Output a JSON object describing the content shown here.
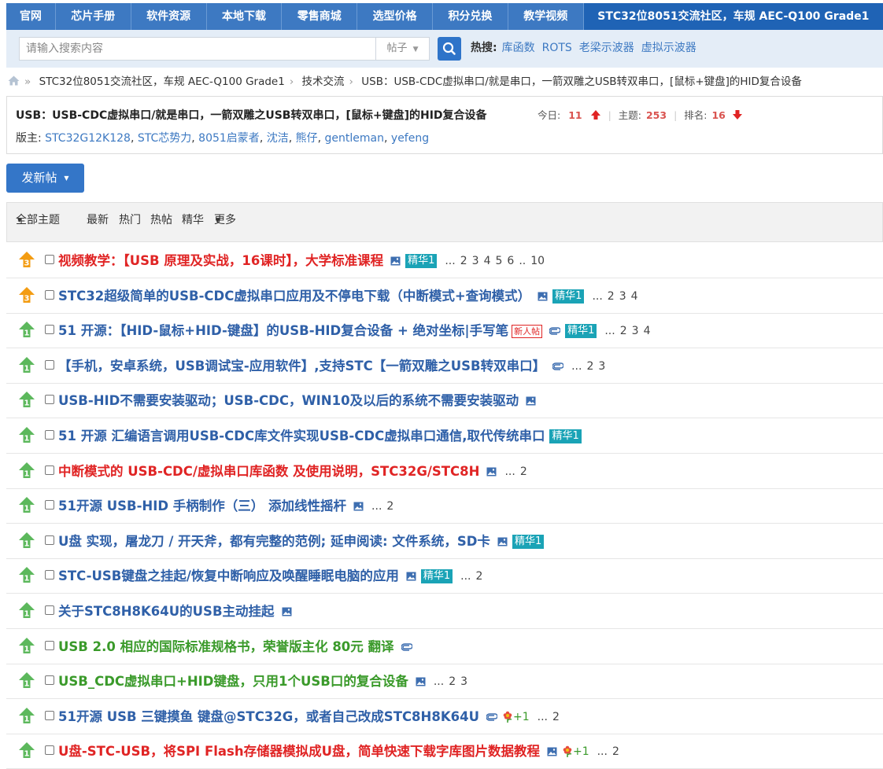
{
  "nav": {
    "items": [
      "官网",
      "芯片手册",
      "软件资源",
      "本地下载",
      "零售商城",
      "选型价格",
      "积分兑换",
      "教学视频"
    ],
    "active": "STC32位8051交流社区，车规 AEC-Q100 Grade1"
  },
  "search": {
    "placeholder": "请输入搜索内容",
    "type": "帖子",
    "hot_label": "热搜:",
    "hot": [
      "库函数",
      "ROTS",
      "老梁示波器",
      "虚拟示波器"
    ]
  },
  "breadcrumb": [
    "STC32位8051交流社区，车规 AEC-Q100 Grade1",
    "技术交流",
    "USB：USB-CDC虚拟串口/就是串口，一箭双雕之USB转双串口，[鼠标+键盘]的HID复合设备"
  ],
  "forum": {
    "title": "USB：USB-CDC虚拟串口/就是串口，一箭双雕之USB转双串口，[鼠标+键盘]的HID复合设备",
    "today_label": "今日:",
    "today": "11",
    "topics_label": "主题:",
    "topics": "253",
    "rank_label": "排名:",
    "rank": "16",
    "mods_label": "版主:",
    "mods": [
      "STC32G12K128",
      "STC芯势力",
      "8051启蒙者",
      "沈洁",
      "熊仔",
      "gentleman",
      "yefeng"
    ]
  },
  "new_post_label": "发新帖",
  "filters": {
    "all": "全部主题",
    "latest": "最新",
    "hot": "热门",
    "hotposts": "热帖",
    "digest": "精华",
    "more": "更多"
  },
  "colors": {
    "nav": "#3d79c2",
    "nav_active": "#1f63b5",
    "red": "#e02424",
    "blue": "#2f60a8",
    "green": "#3a9a2a",
    "digest": "#1aa3b6"
  },
  "threads": [
    {
      "icon": "pin-3-icon",
      "title": "视频教学：【USB 原理及实战，16课时】，大学标准课程",
      "color": "red",
      "image": true,
      "clip": false,
      "new": false,
      "digest": "精华1",
      "flower": "",
      "pages": [
        "...",
        "2",
        "3",
        "4",
        "5",
        "6",
        "..",
        "10"
      ]
    },
    {
      "icon": "pin-3-icon",
      "title": "STC32超级简单的USB-CDC虚拟串口应用及不停电下载（中断模式+查询模式）",
      "color": "blue",
      "image": true,
      "clip": false,
      "new": false,
      "digest": "精华1",
      "flower": "",
      "pages": [
        "...",
        "2",
        "3",
        "4"
      ]
    },
    {
      "icon": "pin-1-icon",
      "title": "51 开源：【HID-鼠标+HID-键盘】的USB-HID复合设备 + 绝对坐标|手写笔",
      "color": "blue",
      "image": false,
      "clip": true,
      "new": true,
      "new_label": "新人帖",
      "digest": "精华1",
      "flower": "",
      "pages": [
        "...",
        "2",
        "3",
        "4"
      ]
    },
    {
      "icon": "pin-1-icon",
      "title": "【手机，安卓系统，USB调试宝-应用软件】,支持STC【一箭双雕之USB转双串口】",
      "color": "blue",
      "image": false,
      "clip": true,
      "new": false,
      "digest": "",
      "flower": "",
      "pages": [
        "...",
        "2",
        "3"
      ]
    },
    {
      "icon": "pin-1-icon",
      "title": "USB-HID不需要安装驱动；USB-CDC，WIN10及以后的系统不需要安装驱动",
      "color": "blue",
      "image": true,
      "clip": false,
      "new": false,
      "digest": "",
      "flower": "",
      "pages": []
    },
    {
      "icon": "pin-1-icon",
      "title": "51 开源 汇编语言调用USB-CDC库文件实现USB-CDC虚拟串口通信,取代传统串口",
      "color": "blue",
      "image": false,
      "clip": false,
      "new": false,
      "digest": "精华1",
      "flower": "",
      "pages": []
    },
    {
      "icon": "pin-1-icon",
      "title": "中断模式的 USB-CDC/虚拟串口库函数 及使用说明，STC32G/STC8H",
      "color": "red",
      "image": true,
      "clip": false,
      "new": false,
      "digest": "",
      "flower": "",
      "pages": [
        "...",
        "2"
      ]
    },
    {
      "icon": "pin-1-icon",
      "title": "51开源 USB-HID 手柄制作（三） 添加线性摇杆",
      "color": "blue",
      "image": true,
      "clip": false,
      "new": false,
      "digest": "",
      "flower": "",
      "pages": [
        "...",
        "2"
      ]
    },
    {
      "icon": "pin-1-icon",
      "title": "U盘 实现，屠龙刀 / 开天斧，都有完整的范例; 延申阅读: 文件系统，SD卡",
      "color": "blue",
      "image": true,
      "clip": false,
      "new": false,
      "digest": "精华1",
      "flower": "",
      "pages": []
    },
    {
      "icon": "pin-1-icon",
      "title": "STC-USB键盘之挂起/恢复中断响应及唤醒睡眠电脑的应用",
      "color": "blue",
      "image": true,
      "clip": false,
      "new": false,
      "digest": "精华1",
      "flower": "",
      "pages": [
        "...",
        "2"
      ]
    },
    {
      "icon": "pin-1-icon",
      "title": "关于STC8H8K64U的USB主动挂起",
      "color": "blue",
      "image": true,
      "clip": false,
      "new": false,
      "digest": "",
      "flower": "",
      "pages": []
    },
    {
      "icon": "pin-1-icon",
      "title": "USB 2.0 相应的国际标准规格书，荣誉版主化 80元 翻译",
      "color": "green",
      "image": false,
      "clip": true,
      "new": false,
      "digest": "",
      "flower": "",
      "pages": []
    },
    {
      "icon": "pin-1-icon",
      "title": "USB_CDC虚拟串口+HID键盘，只用1个USB口的复合设备",
      "color": "green",
      "image": true,
      "clip": false,
      "new": false,
      "digest": "",
      "flower": "",
      "pages": [
        "...",
        "2",
        "3"
      ]
    },
    {
      "icon": "pin-1-icon",
      "title": "51开源 USB 三键摸鱼 键盘@STC32G，或者自己改成STC8H8K64U",
      "color": "blue",
      "image": false,
      "clip": true,
      "new": false,
      "digest": "",
      "flower": "+1",
      "pages": [
        "...",
        "2"
      ]
    },
    {
      "icon": "pin-1-icon",
      "title": "U盘-STC-USB，将SPI Flash存储器模拟成U盘，简单快速下载字库图片数据教程",
      "color": "red",
      "image": true,
      "clip": false,
      "new": false,
      "digest": "",
      "flower": "+1",
      "pages": [
        "...",
        "2"
      ]
    }
  ]
}
